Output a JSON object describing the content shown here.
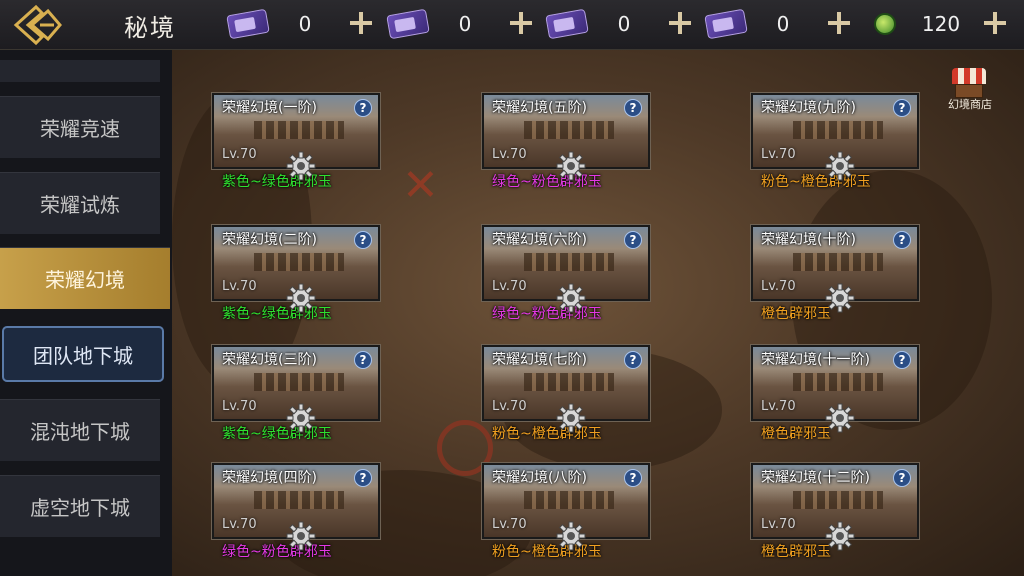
{
  "header": {
    "title": "秘境",
    "resources": [
      {
        "icon": "purple-ticket-icon",
        "count": "0"
      },
      {
        "icon": "purple-ticket-icon",
        "count": "0"
      },
      {
        "icon": "purple-ticket-icon",
        "count": "0"
      },
      {
        "icon": "purple-ticket-icon",
        "count": "0"
      },
      {
        "icon": "green-coin-icon",
        "count": "120"
      }
    ]
  },
  "sidebar": {
    "items": [
      {
        "label": "荣耀竞速",
        "state": "normal"
      },
      {
        "label": "荣耀试炼",
        "state": "normal"
      },
      {
        "label": "荣耀幻境",
        "state": "active"
      },
      {
        "label": "团队地下城",
        "state": "highlighted"
      },
      {
        "label": "混沌地下城",
        "state": "normal"
      },
      {
        "label": "虚空地下城",
        "state": "normal"
      }
    ]
  },
  "shop": {
    "label": "幻境商店"
  },
  "colors": {
    "green": "#2fe02f",
    "pink": "#e438e4",
    "orange": "#f0a020",
    "active_tab": "#c7a04a"
  },
  "cards": [
    {
      "name": "荣耀幻境(一阶)",
      "level": "Lv.70",
      "drop": "紫色~绿色辟邪玉",
      "drop_color": "#2fe02f"
    },
    {
      "name": "荣耀幻境(二阶)",
      "level": "Lv.70",
      "drop": "紫色~绿色辟邪玉",
      "drop_color": "#2fe02f"
    },
    {
      "name": "荣耀幻境(三阶)",
      "level": "Lv.70",
      "drop": "紫色~绿色辟邪玉",
      "drop_color": "#2fe02f"
    },
    {
      "name": "荣耀幻境(四阶)",
      "level": "Lv.70",
      "drop": "绿色~粉色辟邪玉",
      "drop_color": "#e438e4"
    },
    {
      "name": "荣耀幻境(五阶)",
      "level": "Lv.70",
      "drop": "绿色~粉色辟邪玉",
      "drop_color": "#e438e4"
    },
    {
      "name": "荣耀幻境(六阶)",
      "level": "Lv.70",
      "drop": "绿色~粉色辟邪玉",
      "drop_color": "#e438e4"
    },
    {
      "name": "荣耀幻境(七阶)",
      "level": "Lv.70",
      "drop": "粉色~橙色辟邪玉",
      "drop_color": "#f0a020"
    },
    {
      "name": "荣耀幻境(八阶)",
      "level": "Lv.70",
      "drop": "粉色~橙色辟邪玉",
      "drop_color": "#f0a020"
    },
    {
      "name": "荣耀幻境(九阶)",
      "level": "Lv.70",
      "drop": "粉色~橙色辟邪玉",
      "drop_color": "#f0a020"
    },
    {
      "name": "荣耀幻境(十阶)",
      "level": "Lv.70",
      "drop": "橙色辟邪玉",
      "drop_color": "#f0a020"
    },
    {
      "name": "荣耀幻境(十一阶)",
      "level": "Lv.70",
      "drop": "橙色辟邪玉",
      "drop_color": "#f0a020"
    },
    {
      "name": "荣耀幻境(十二阶)",
      "level": "Lv.70",
      "drop": "橙色辟邪玉",
      "drop_color": "#f0a020"
    }
  ]
}
